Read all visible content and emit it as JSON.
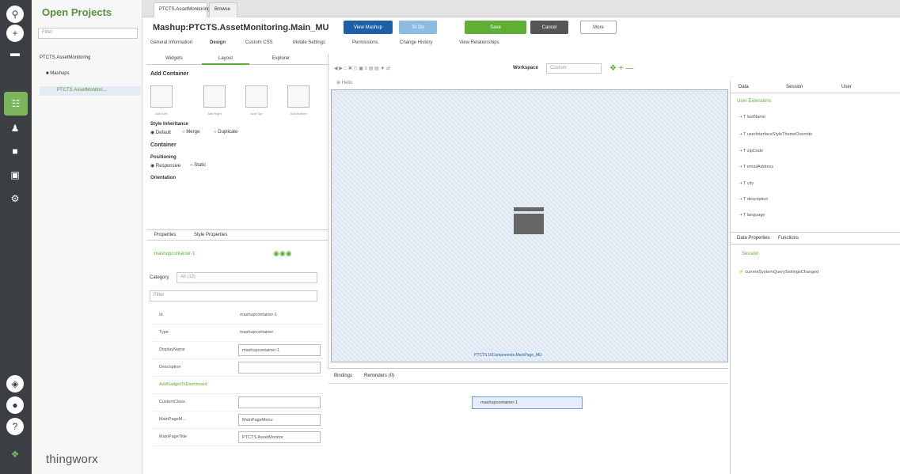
{
  "project_panel": {
    "title": "Open Projects",
    "filter_placeholder": "Filter",
    "tree": [
      "PTCTS.AssetMonitoring",
      "Mashups",
      "PTCTS.AssetMonitori..."
    ],
    "brand": "thingworx"
  },
  "browser_tabs": [
    "PTCTS.AssetMonitoring...",
    "Browse"
  ],
  "mashup": {
    "title": "Mashup:PTCTS.AssetMonitoring.Main_MU",
    "buttons": {
      "view": "View Mashup",
      "todo": "To Do",
      "save": "Save",
      "cancel": "Cancel",
      "more": "More"
    }
  },
  "sub_tabs": [
    "General Information",
    "Design",
    "Custom CSS",
    "Mobile Settings",
    "Permissions",
    "Change History",
    "View Relationships"
  ],
  "widget_panel": {
    "tabs": [
      "Widgets",
      "Layout",
      "Explorer"
    ],
    "add_container": "Add Container",
    "tiles": [
      "Add Left",
      "Add Right",
      "Add Top",
      "Add Bottom"
    ],
    "style_inheritance": "Style Inheritance",
    "style_options": [
      "Default",
      "Merge",
      "Duplicate"
    ],
    "container": "Container",
    "positioning": "Positioning",
    "positioning_options": [
      "Responsive",
      "Static"
    ],
    "orientation": "Orientation"
  },
  "properties_panel": {
    "tabs": [
      "Properties",
      "Style Properties"
    ],
    "selected": "mashupcontainer-1",
    "category_label": "Category",
    "category_value": "All (13)",
    "filter_placeholder": "Filter",
    "rows": [
      {
        "name": "Id",
        "value": "mashupcontainer-1"
      },
      {
        "name": "Type",
        "value": "mashupcontainer"
      },
      {
        "name": "DisplayName",
        "value": "mashupcontainer-1"
      },
      {
        "name": "Description",
        "value": ""
      },
      {
        "name": "AddGadgetToDashboard",
        "value": ""
      },
      {
        "name": "CustomClass",
        "value": ""
      },
      {
        "name": "MainPageM...",
        "value": "MainPageMenu"
      },
      {
        "name": "MainPageTitle",
        "value": "PTCTS.AssetMonitor"
      }
    ]
  },
  "canvas": {
    "toolbar_workspace": "Workspace",
    "workspace_value": "Custom",
    "label": "Hello",
    "footer_text": "PTCTS.UIComponents.MainPage_MU"
  },
  "bottom_panel": {
    "tabs": [
      "Bindings",
      "Reminders (0)"
    ],
    "node": "mashupcontainer-1"
  },
  "right_panel": {
    "tabs": [
      "Data",
      "Session",
      "User"
    ],
    "user_extensions": "User Extensions",
    "user_fields": [
      "lastName",
      "userInterfaceStyleThemeOverride",
      "zipCode",
      "emailAddress",
      "city",
      "description",
      "language"
    ],
    "lower_tabs": [
      "Data Properties",
      "Functions"
    ],
    "section": "Session",
    "event": "currentSystemQuerySettingsChanged"
  },
  "colors": {
    "rail": "#3b3f44",
    "green": "#5fae35",
    "blue": "#1f5fa8"
  }
}
